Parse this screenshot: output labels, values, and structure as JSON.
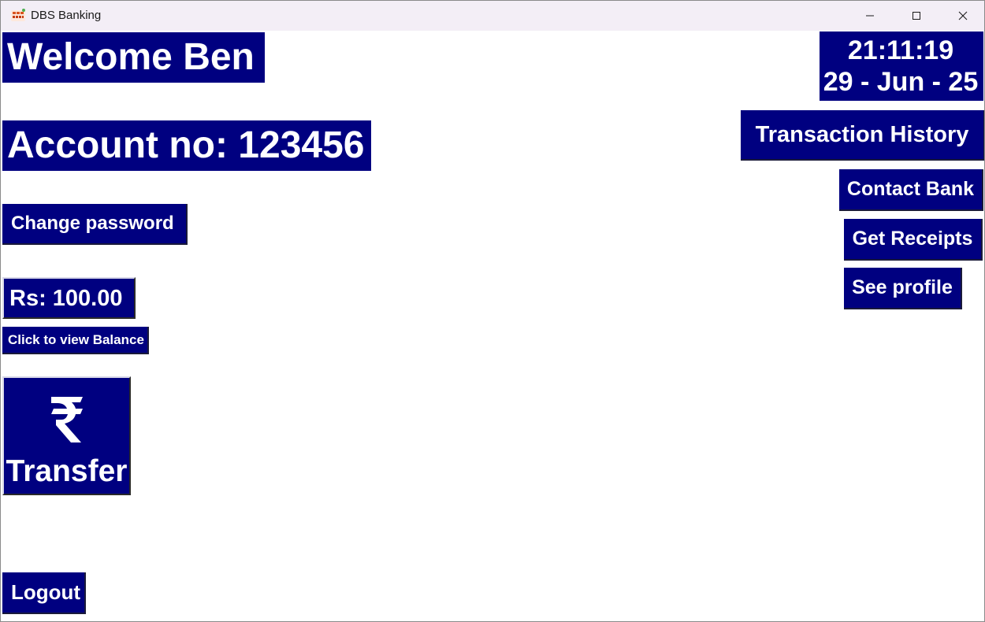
{
  "window": {
    "title": "DBS Banking",
    "icon": "dbs-bank-logo-icon",
    "controls": [
      "minimize-icon",
      "maximize-icon",
      "close-icon"
    ]
  },
  "header": {
    "welcome": "Welcome Ben",
    "account": "Account no: 123456"
  },
  "clock": {
    "time": "21:11:19",
    "date": "29 - Jun - 25"
  },
  "actions": {
    "change_password": "Change password",
    "balance": "Rs: 100.00",
    "view_balance": "Click to view Balance",
    "transfer": "Transfer",
    "transfer_icon": "rupee-icon",
    "logout": "Logout",
    "transaction_history": "Transaction History",
    "contact_bank": "Contact Bank",
    "get_receipts": "Get Receipts",
    "see_profile": "See profile"
  },
  "colors": {
    "button_background": "#000080",
    "button_text": "#ffffff",
    "titlebar": "#f3eef6",
    "window_background": "#ffffff"
  }
}
